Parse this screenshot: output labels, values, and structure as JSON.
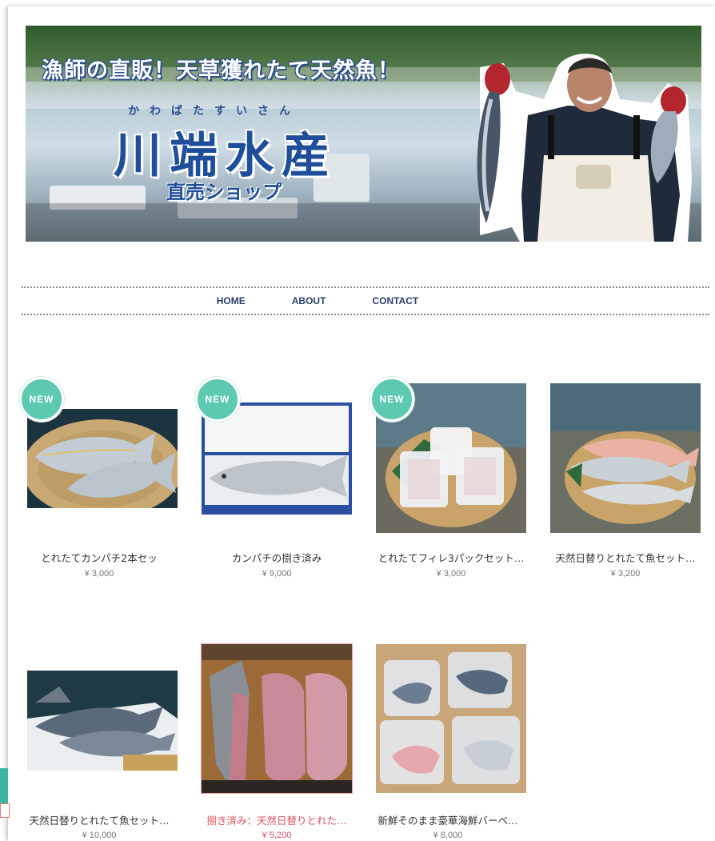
{
  "banner": {
    "tagline": "漁師の直販！天草獲れたて天然魚！",
    "ruby": "かわばたすいさん",
    "title": "川端水産",
    "subtitle": "直売ショップ"
  },
  "nav": {
    "items": [
      {
        "label": "HOME"
      },
      {
        "label": "ABOUT"
      },
      {
        "label": "CONTACT"
      }
    ]
  },
  "badge_label": "NEW",
  "products": [
    {
      "name": "とれたてカンパチ2本セッ",
      "price": "¥ 3,000",
      "new": true
    },
    {
      "name": "カンパチの捌き済み",
      "price": "¥ 9,000",
      "new": true
    },
    {
      "name": "とれたてフィレ3パックセット…",
      "price": "¥ 3,000",
      "new": true
    },
    {
      "name": "天然日替りとれたて魚セット…",
      "price": "¥ 3,200",
      "new": false
    },
    {
      "name": "天然日替りとれたて魚セット…",
      "price": "¥ 10,000",
      "new": false
    },
    {
      "name": "捌き済み：天然日替りとれた…",
      "price": "¥ 5,200",
      "new": false,
      "highlight": true
    },
    {
      "name": "新鮮そのまま豪華海鮮バーベ…",
      "price": "¥ 8,000",
      "new": false
    }
  ],
  "colors": {
    "accent_badge": "#5cc9b0",
    "nav_text": "#2c3e6b",
    "sale_text": "#e0505a",
    "title_blue": "#1f4f9a"
  }
}
